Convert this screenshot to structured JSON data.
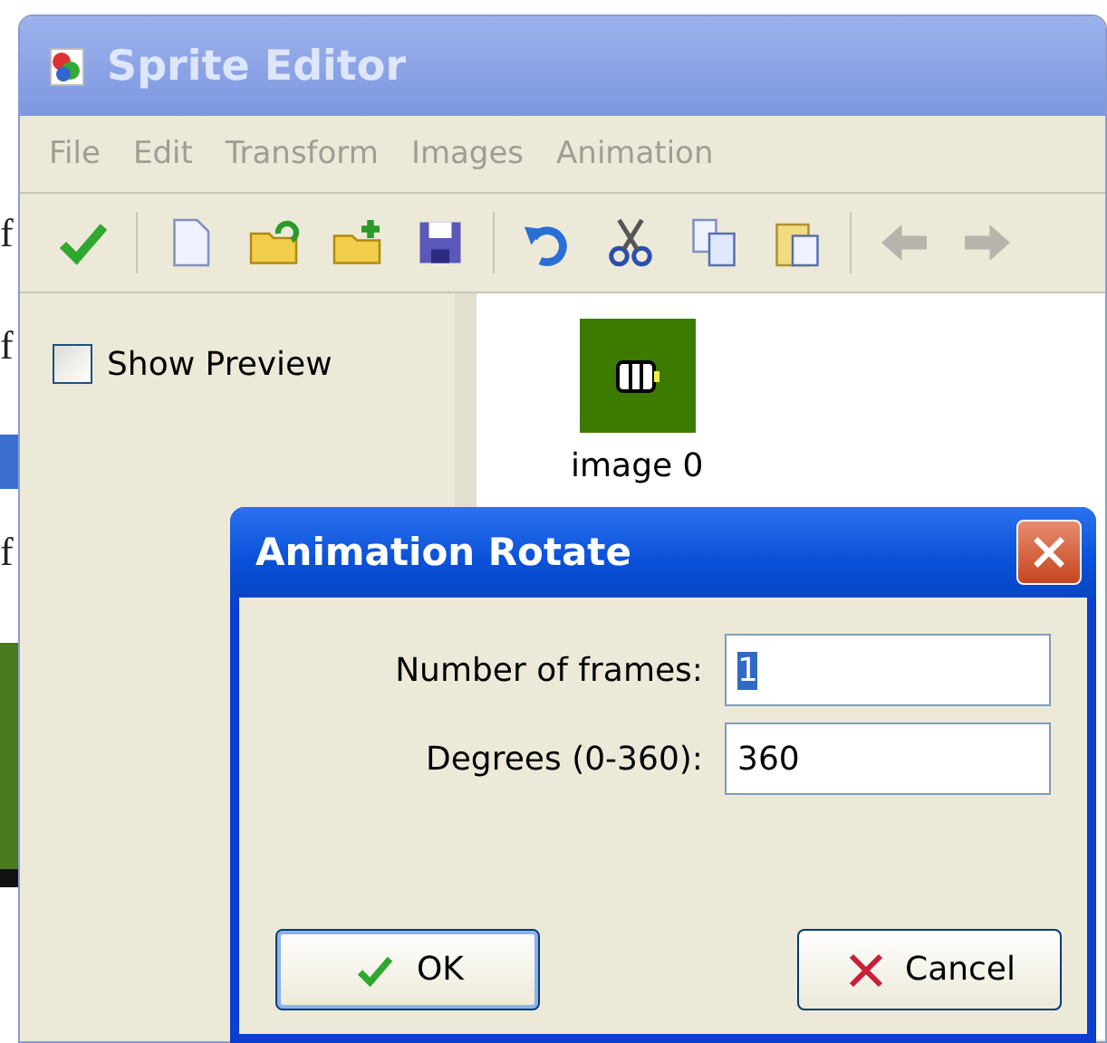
{
  "background_fragments": [
    "f",
    "f",
    "f"
  ],
  "window": {
    "title": "Sprite Editor",
    "active": false
  },
  "menu": [
    "File",
    "Edit",
    "Transform",
    "Images",
    "Animation"
  ],
  "toolbar": [
    [
      {
        "disabled": false
      }
    ],
    [
      {
        "disabled": false
      },
      {
        "disabled": false
      },
      {
        "disabled": false
      },
      {
        "disabled": false
      }
    ],
    [
      {
        "disabled": false
      },
      {
        "disabled": false
      },
      {
        "disabled": false
      },
      {
        "disabled": false
      }
    ],
    [
      {
        "disabled": true
      },
      {
        "disabled": true
      }
    ]
  ],
  "sidebar": {
    "show_preview": {
      "label": "Show Preview",
      "checked": false
    }
  },
  "images": [
    {
      "label": "image 0",
      "selected": false
    }
  ],
  "dialog": {
    "title": "Animation Rotate",
    "fields": [
      {
        "label": "Number of frames:",
        "value": "1",
        "highlighted": true
      },
      {
        "label": "Degrees (0-360):",
        "value": "360",
        "highlighted": false
      }
    ],
    "buttons": [
      {
        "kind": "ok",
        "label": "OK"
      },
      {
        "kind": "cancel",
        "label": "Cancel"
      }
    ]
  }
}
